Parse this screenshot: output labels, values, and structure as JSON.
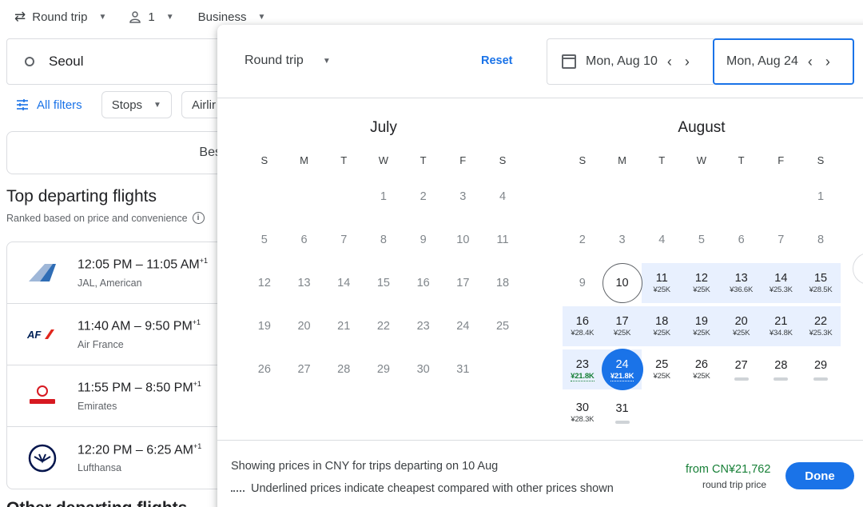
{
  "topbar": {
    "trip_type": "Round trip",
    "passengers": "1",
    "cabin": "Business"
  },
  "search": {
    "origin": "Seoul"
  },
  "filters": {
    "all_filters": "All filters",
    "stops": "Stops",
    "airlines_partial": "Airlir"
  },
  "sort": {
    "best_partial": "Bes"
  },
  "results": {
    "title": "Top departing flights",
    "subtitle": "Ranked based on price and convenience",
    "flights": [
      {
        "times": "12:05 PM – 11:05 AM",
        "plus": "+1",
        "airline": "JAL, American",
        "logo_icon": "jal-logo-icon"
      },
      {
        "times": "11:40 AM – 9:50 PM",
        "plus": "+1",
        "airline": "Air France",
        "logo_icon": "air-france-logo-icon"
      },
      {
        "times": "11:55 PM – 8:50 PM",
        "plus": "+1",
        "airline": "Emirates",
        "logo_icon": "emirates-logo-icon"
      },
      {
        "times": "12:20 PM – 6:25 AM",
        "plus": "+1",
        "airline": "Lufthansa",
        "logo_icon": "lufthansa-logo-icon"
      }
    ],
    "other_title_partial": "Other departing flights"
  },
  "picker": {
    "trip_type": "Round trip",
    "reset": "Reset",
    "depart_date": "Mon, Aug 10",
    "return_date": "Mon, Aug 24",
    "months": [
      {
        "name": "July",
        "dow": [
          "S",
          "M",
          "T",
          "W",
          "T",
          "F",
          "S"
        ]
      },
      {
        "name": "August",
        "dow": [
          "S",
          "M",
          "T",
          "W",
          "T",
          "F",
          "S"
        ]
      }
    ],
    "july_days": [
      "1",
      "2",
      "3",
      "4",
      "5",
      "6",
      "7",
      "8",
      "9",
      "10",
      "11",
      "12",
      "13",
      "14",
      "15",
      "16",
      "17",
      "18",
      "19",
      "20",
      "21",
      "22",
      "23",
      "24",
      "25",
      "26",
      "27",
      "28",
      "29",
      "30",
      "31"
    ],
    "august_days": [
      {
        "d": "1",
        "p": ""
      },
      {
        "d": "2",
        "p": ""
      },
      {
        "d": "3",
        "p": ""
      },
      {
        "d": "4",
        "p": ""
      },
      {
        "d": "5",
        "p": ""
      },
      {
        "d": "6",
        "p": ""
      },
      {
        "d": "7",
        "p": ""
      },
      {
        "d": "8",
        "p": ""
      },
      {
        "d": "9",
        "p": ""
      },
      {
        "d": "10",
        "p": ""
      },
      {
        "d": "11",
        "p": "¥25K"
      },
      {
        "d": "12",
        "p": "¥25K"
      },
      {
        "d": "13",
        "p": "¥36.6K"
      },
      {
        "d": "14",
        "p": "¥25.3K"
      },
      {
        "d": "15",
        "p": "¥28.5K"
      },
      {
        "d": "16",
        "p": "¥28.4K"
      },
      {
        "d": "17",
        "p": "¥25K"
      },
      {
        "d": "18",
        "p": "¥25K"
      },
      {
        "d": "19",
        "p": "¥25K"
      },
      {
        "d": "20",
        "p": "¥25K"
      },
      {
        "d": "21",
        "p": "¥34.8K"
      },
      {
        "d": "22",
        "p": "¥25.3K"
      },
      {
        "d": "23",
        "p": "¥21.8K"
      },
      {
        "d": "24",
        "p": "¥21.8K"
      },
      {
        "d": "25",
        "p": "¥25K"
      },
      {
        "d": "26",
        "p": "¥25K"
      },
      {
        "d": "27",
        "p": "blur"
      },
      {
        "d": "28",
        "p": "blur"
      },
      {
        "d": "29",
        "p": "blur"
      },
      {
        "d": "30",
        "p": "¥28.3K"
      },
      {
        "d": "31",
        "p": "blur"
      }
    ],
    "footer_note1": "Showing prices in CNY for trips departing on 10 Aug",
    "footer_note2": "Underlined prices indicate cheapest compared with other prices shown",
    "from_price": "from CN¥21,762",
    "price_label": "round trip price",
    "done": "Done"
  },
  "colors": {
    "accent": "#1a73e8",
    "cheap": "#188038",
    "range": "#e8f0fe"
  }
}
